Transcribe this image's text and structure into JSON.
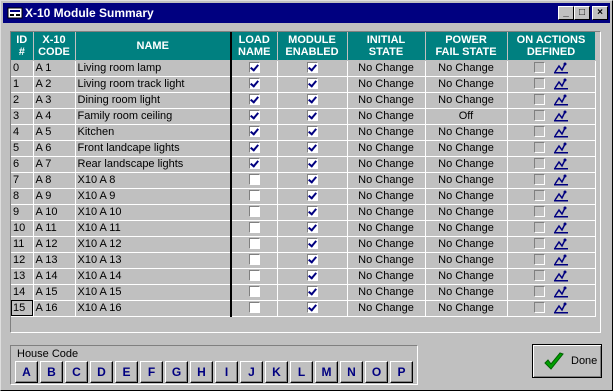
{
  "window": {
    "title": "X-10 Module Summary",
    "minimize": "_",
    "maximize": "□",
    "close": "×"
  },
  "columns": {
    "id": [
      "ID",
      "#"
    ],
    "code": [
      "X-10",
      "CODE"
    ],
    "name": [
      "NAME"
    ],
    "load_name": [
      "LOAD",
      "NAME"
    ],
    "module_enabled": [
      "MODULE",
      "ENABLED"
    ],
    "initial_state": [
      "INITIAL",
      "STATE"
    ],
    "power_fail_state": [
      "POWER",
      "FAIL STATE"
    ],
    "on_actions_defined": [
      "ON ACTIONS",
      "DEFINED"
    ]
  },
  "rows": [
    {
      "id": "0",
      "code": "A 1",
      "name": "Living room lamp",
      "load_name": true,
      "enabled": true,
      "initial": "No Change",
      "power_fail": "No Change"
    },
    {
      "id": "1",
      "code": "A 2",
      "name": "Living room track light",
      "load_name": true,
      "enabled": true,
      "initial": "No Change",
      "power_fail": "No Change"
    },
    {
      "id": "2",
      "code": "A 3",
      "name": "Dining room light",
      "load_name": true,
      "enabled": true,
      "initial": "No Change",
      "power_fail": "No Change"
    },
    {
      "id": "3",
      "code": "A 4",
      "name": "Family room ceiling",
      "load_name": true,
      "enabled": true,
      "initial": "No Change",
      "power_fail": "Off"
    },
    {
      "id": "4",
      "code": "A 5",
      "name": "Kitchen",
      "load_name": true,
      "enabled": true,
      "initial": "No Change",
      "power_fail": "No Change"
    },
    {
      "id": "5",
      "code": "A 6",
      "name": "Front landcape lights",
      "load_name": true,
      "enabled": true,
      "initial": "No Change",
      "power_fail": "No Change"
    },
    {
      "id": "6",
      "code": "A 7",
      "name": "Rear landscape lights",
      "load_name": true,
      "enabled": true,
      "initial": "No Change",
      "power_fail": "No Change"
    },
    {
      "id": "7",
      "code": "A 8",
      "name": "X10 A 8",
      "load_name": false,
      "enabled": true,
      "initial": "No Change",
      "power_fail": "No Change"
    },
    {
      "id": "8",
      "code": "A 9",
      "name": "X10 A 9",
      "load_name": false,
      "enabled": true,
      "initial": "No Change",
      "power_fail": "No Change"
    },
    {
      "id": "9",
      "code": "A 10",
      "name": "X10 A 10",
      "load_name": false,
      "enabled": true,
      "initial": "No Change",
      "power_fail": "No Change"
    },
    {
      "id": "10",
      "code": "A 11",
      "name": "X10 A 11",
      "load_name": false,
      "enabled": true,
      "initial": "No Change",
      "power_fail": "No Change"
    },
    {
      "id": "11",
      "code": "A 12",
      "name": "X10 A 12",
      "load_name": false,
      "enabled": true,
      "initial": "No Change",
      "power_fail": "No Change"
    },
    {
      "id": "12",
      "code": "A 13",
      "name": "X10 A 13",
      "load_name": false,
      "enabled": true,
      "initial": "No Change",
      "power_fail": "No Change"
    },
    {
      "id": "13",
      "code": "A 14",
      "name": "X10 A 14",
      "load_name": false,
      "enabled": true,
      "initial": "No Change",
      "power_fail": "No Change"
    },
    {
      "id": "14",
      "code": "A 15",
      "name": "X10 A 15",
      "load_name": false,
      "enabled": true,
      "initial": "No Change",
      "power_fail": "No Change"
    },
    {
      "id": "15",
      "code": "A 16",
      "name": "X10 A 16",
      "load_name": false,
      "enabled": true,
      "initial": "No Change",
      "power_fail": "No Change"
    }
  ],
  "selected_row": "15",
  "house_code": {
    "label": "House Code",
    "letters": [
      "A",
      "B",
      "C",
      "D",
      "E",
      "F",
      "G",
      "H",
      "I",
      "J",
      "K",
      "L",
      "M",
      "N",
      "O",
      "P"
    ]
  },
  "done": {
    "label": "Done",
    "icon": "checkmark-icon"
  },
  "colors": {
    "title_bar": "#000080",
    "header": "#008080",
    "check": "#000080",
    "done_check": "#00a000"
  }
}
